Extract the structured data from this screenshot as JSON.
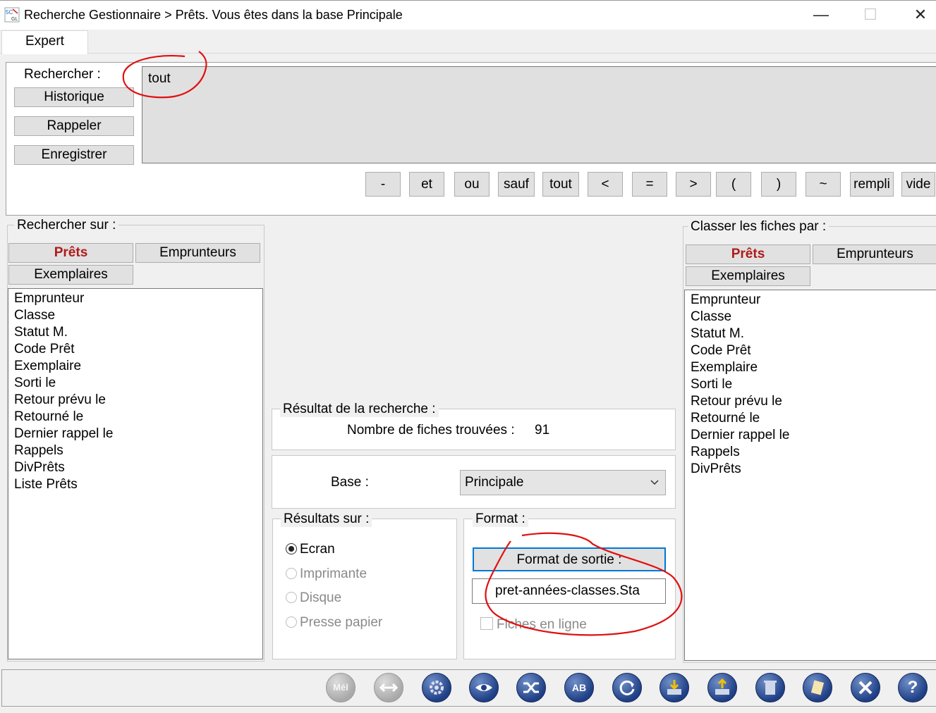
{
  "window": {
    "title": "Recherche Gestionnaire > Prêts.  Vous êtes dans la base Principale",
    "icon": "app-icon",
    "minimize": "—",
    "maximize": "☐",
    "close": "✕"
  },
  "tabs": [
    {
      "label": "Expert",
      "active": true
    }
  ],
  "search": {
    "label": "Rechercher :",
    "value": "tout",
    "history_button": "Historique",
    "recall_button": "Rappeler",
    "save_button": "Enregistrer",
    "operators": [
      "-",
      "et",
      "ou",
      "sauf",
      "tout",
      "<",
      "=",
      ">",
      "(",
      ")",
      "~",
      "rempli",
      "vide"
    ]
  },
  "search_on": {
    "legend": "Rechercher sur :",
    "tabs": [
      "Prêts",
      "Emprunteurs",
      "Exemplaires"
    ],
    "active_tab": "Prêts",
    "fields": [
      "Emprunteur",
      "Classe",
      "Statut M.",
      "Code Prêt",
      "Exemplaire",
      "Sorti le",
      "Retour prévu le",
      "Retourné le",
      "Dernier rappel le",
      "Rappels",
      "DivPrêts",
      "Liste Prêts"
    ]
  },
  "sort_by": {
    "legend": "Classer les fiches par :",
    "tabs": [
      "Prêts",
      "Emprunteurs",
      "Exemplaires"
    ],
    "active_tab": "Prêts",
    "fields": [
      "Emprunteur",
      "Classe",
      "Statut M.",
      "Code Prêt",
      "Exemplaire",
      "Sorti le",
      "Retour prévu le",
      "Retourné le",
      "Dernier rappel le",
      "Rappels",
      "DivPrêts"
    ]
  },
  "result": {
    "legend": "Résultat de la recherche :",
    "count_label": "Nombre de fiches trouvées :",
    "count": "91"
  },
  "base": {
    "label": "Base :",
    "selected": "Principale"
  },
  "output": {
    "legend": "Résultats sur :",
    "options": [
      {
        "label": "Ecran",
        "checked": true,
        "enabled": true
      },
      {
        "label": "Imprimante",
        "checked": false,
        "enabled": false
      },
      {
        "label": "Disque",
        "checked": false,
        "enabled": false
      },
      {
        "label": "Presse papier",
        "checked": false,
        "enabled": false
      }
    ]
  },
  "format": {
    "legend": "Format :",
    "button": "Format de sortie :",
    "file": "pret-années-classes.Sta",
    "inline_label": "Fiches en ligne",
    "inline_checked": false
  },
  "toolbar": {
    "icons": [
      "mail-icon",
      "link-icon",
      "gear-icon",
      "eye-icon",
      "shuffle-icon",
      "spellcheck-icon",
      "refresh-icon",
      "import-icon",
      "export-icon",
      "trash-icon",
      "eraser-icon",
      "close-icon",
      "help-icon"
    ],
    "mail_text": "Mél",
    "spell_text": "AB",
    "help_text": "?"
  },
  "colors": {
    "annotation": "#e01010",
    "active_tab_text": "#b01a1a"
  }
}
